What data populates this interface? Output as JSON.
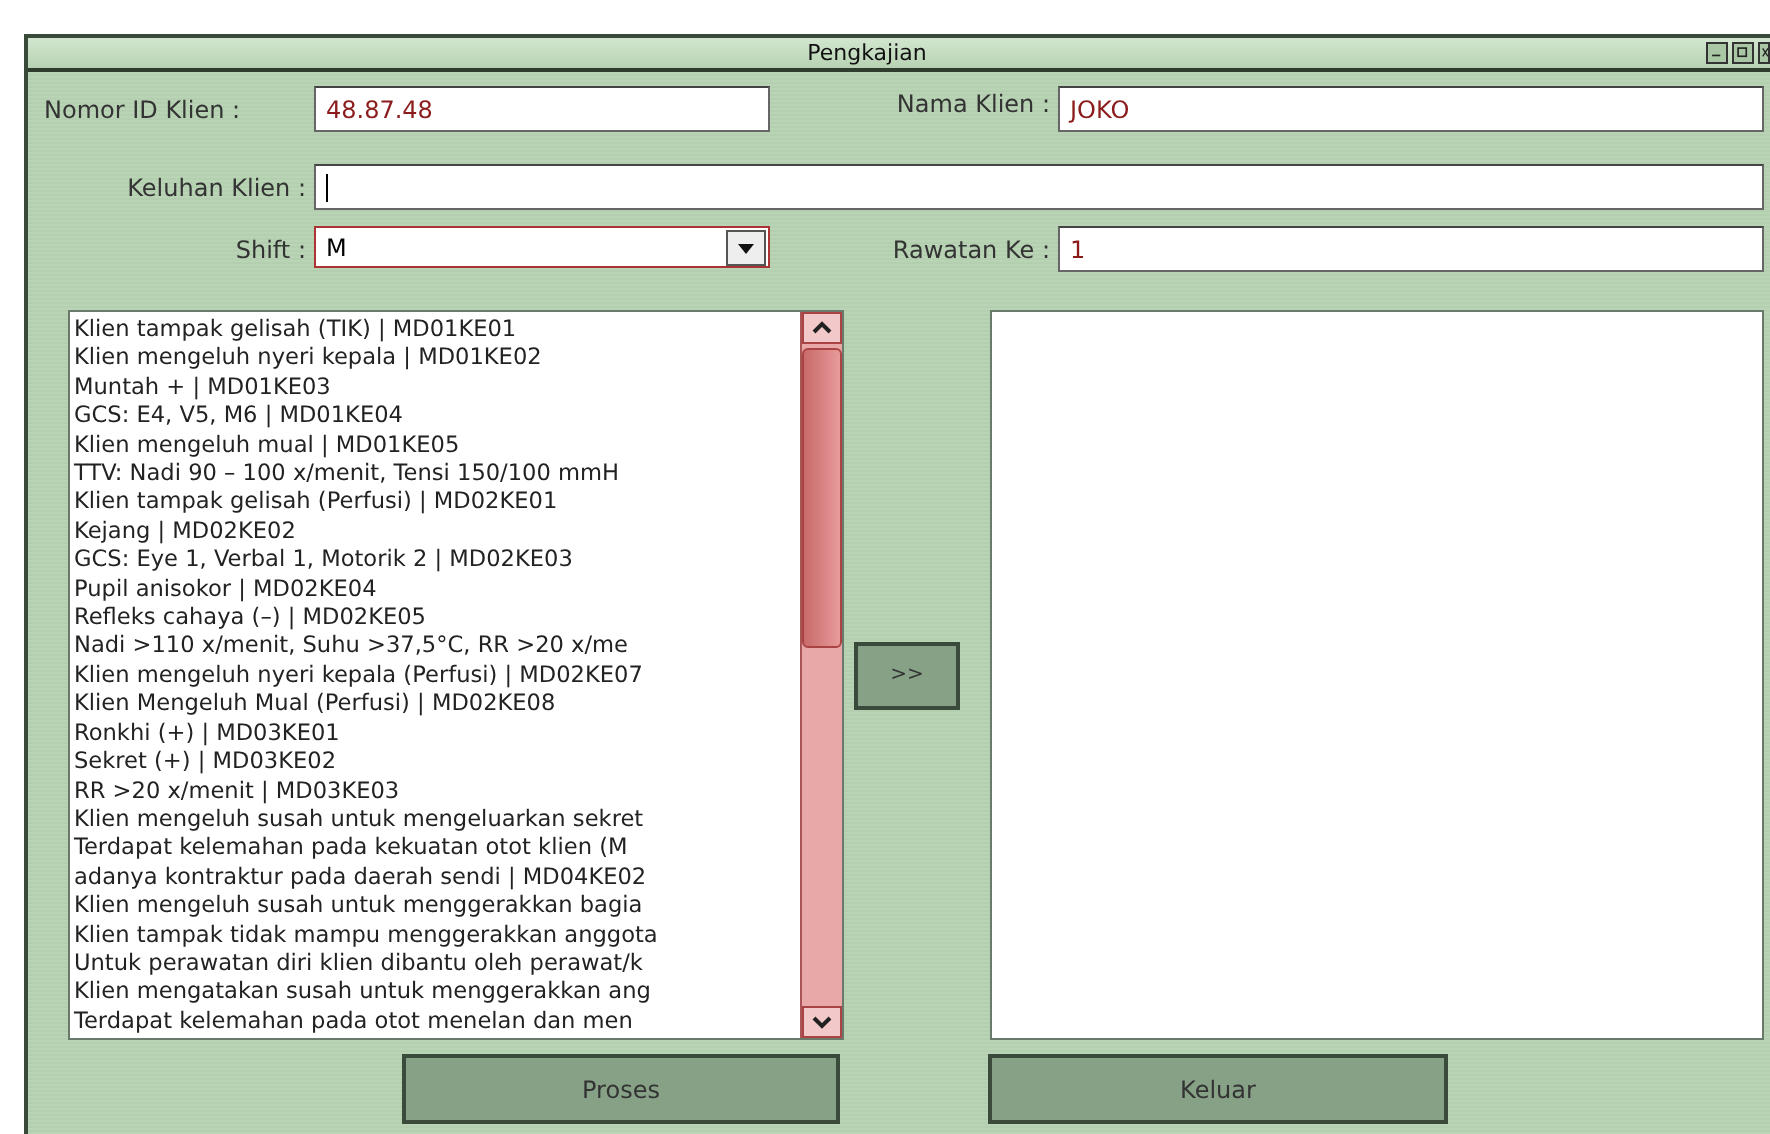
{
  "window": {
    "title": "Pengkajian"
  },
  "form": {
    "nomor_id": {
      "label": "Nomor ID Klien :",
      "value": "48.87.48"
    },
    "nama": {
      "label": "Nama Klien :",
      "value": "JOKO"
    },
    "keluhan": {
      "label": "Keluhan Klien :"
    },
    "shift": {
      "label": "Shift :",
      "value": "M"
    },
    "rawatan": {
      "label": "Rawatan Ke :",
      "value": "1"
    }
  },
  "source_list": {
    "items": [
      "Klien tampak gelisah (TIK) | MD01KE01",
      "Klien mengeluh nyeri kepala | MD01KE02",
      "Muntah + | MD01KE03",
      "GCS: E4, V5, M6 | MD01KE04",
      "Klien mengeluh mual | MD01KE05",
      "TTV: Nadi 90 – 100 x/menit, Tensi 150/100 mmH",
      "Klien tampak gelisah (Perfusi) | MD02KE01",
      "Kejang | MD02KE02",
      "GCS: Eye 1, Verbal 1, Motorik 2 | MD02KE03",
      "Pupil anisokor | MD02KE04",
      "Refleks cahaya (–) | MD02KE05",
      "Nadi >110 x/menit, Suhu >37,5°C, RR >20 x/me",
      "Klien mengeluh nyeri kepala (Perfusi) | MD02KE07",
      "Klien Mengeluh Mual (Perfusi) | MD02KE08",
      "Ronkhi (+) | MD03KE01",
      "Sekret (+) | MD03KE02",
      "RR >20 x/menit | MD03KE03",
      "Klien mengeluh susah untuk mengeluarkan sekret",
      "Terdapat kelemahan pada kekuatan otot klien (M",
      "adanya kontraktur pada daerah sendi | MD04KE02",
      "Klien mengeluh susah untuk menggerakkan bagia",
      "Klien tampak tidak mampu menggerakkan anggota",
      "Untuk perawatan diri klien dibantu oleh perawat/k",
      "Klien mengatakan susah untuk menggerakkan ang",
      "Terdapat kelemahan pada otot menelan dan men"
    ]
  },
  "transfer_button": ">>",
  "buttons": [
    "Proses",
    "Keluar"
  ]
}
